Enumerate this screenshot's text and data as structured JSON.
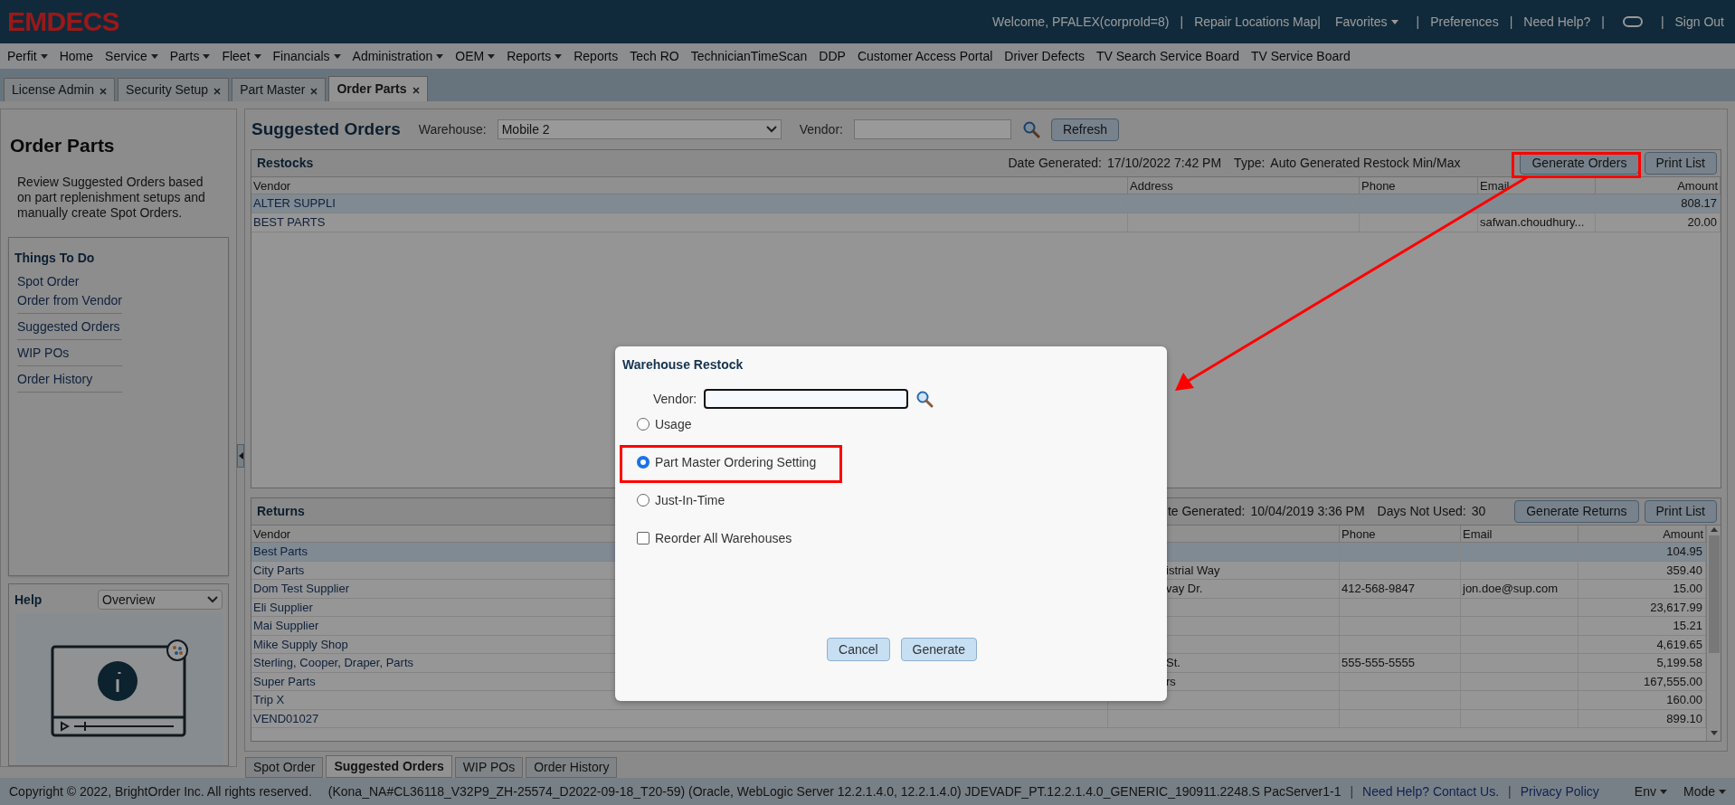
{
  "header": {
    "logo": "EMDECS",
    "items": [
      {
        "kind": "text",
        "label": "Welcome, PFALEX(corproId=8)"
      },
      {
        "kind": "sep",
        "label": "|"
      },
      {
        "kind": "link",
        "label": "Repair Locations Map|"
      },
      {
        "kind": "dropdown",
        "label": "Favorites"
      },
      {
        "kind": "sep",
        "label": "|"
      },
      {
        "kind": "link",
        "label": "Preferences"
      },
      {
        "kind": "sep",
        "label": "|"
      },
      {
        "kind": "link",
        "label": "Need Help?"
      },
      {
        "kind": "sep",
        "label": "|"
      },
      {
        "kind": "toggle",
        "on": false
      },
      {
        "kind": "sep",
        "label": "|"
      },
      {
        "kind": "link",
        "label": "Sign Out"
      }
    ]
  },
  "menu": [
    {
      "label": "Perfit",
      "dropdown": true
    },
    {
      "label": "Home",
      "dropdown": false
    },
    {
      "label": "Service",
      "dropdown": true
    },
    {
      "label": "Parts",
      "dropdown": true
    },
    {
      "label": "Fleet",
      "dropdown": true
    },
    {
      "label": "Financials",
      "dropdown": true
    },
    {
      "label": "Administration",
      "dropdown": true
    },
    {
      "label": "OEM",
      "dropdown": true
    },
    {
      "label": "Reports",
      "dropdown": true
    },
    {
      "label": "Reports",
      "dropdown": false
    },
    {
      "label": "Tech RO",
      "dropdown": false
    },
    {
      "label": "TechnicianTimeScan",
      "dropdown": false
    },
    {
      "label": "DDP",
      "dropdown": false
    },
    {
      "label": "Customer Access Portal",
      "dropdown": false
    },
    {
      "label": "Driver Defects",
      "dropdown": false
    },
    {
      "label": "TV Search Service Board",
      "dropdown": false
    },
    {
      "label": "TV Service Board",
      "dropdown": false
    }
  ],
  "tabs": [
    {
      "label": "License Admin",
      "selected": false
    },
    {
      "label": "Security Setup",
      "selected": false
    },
    {
      "label": "Part Master",
      "selected": false
    },
    {
      "label": "Order Parts",
      "selected": true
    }
  ],
  "sidebar": {
    "title": "Order Parts",
    "description": "Review Suggested Orders based on part replenishment setups and manually create Spot Orders.",
    "things_to_do": {
      "title": "Things To Do",
      "groups": [
        {
          "items": [
            "Spot Order",
            "Order from Vendor"
          ]
        },
        {
          "items": [
            "Suggested Orders"
          ]
        },
        {
          "items": [
            "WIP POs"
          ]
        },
        {
          "items": [
            "Order History"
          ]
        }
      ]
    },
    "help": {
      "title": "Help",
      "topic": "Overview"
    }
  },
  "main": {
    "title": "Suggested Orders",
    "warehouse_label": "Warehouse:",
    "warehouse": "Mobile 2",
    "vendor_label": "Vendor:",
    "refresh": "Refresh",
    "restocks": {
      "title": "Restocks",
      "date_label": "Date Generated:",
      "date": "17/10/2022 7:42 PM",
      "type_label": "Type:",
      "type": "Auto Generated Restock Min/Max",
      "buttons": [
        "Generate Orders",
        "Print List"
      ],
      "columns": [
        {
          "label": "Vendor"
        },
        {
          "label": "Address"
        },
        {
          "label": "Phone"
        },
        {
          "label": "Email"
        },
        {
          "label": "Amount"
        }
      ],
      "rows": [
        {
          "vendor": "ALTER SUPPLI",
          "amount": "808.17",
          "selected": true
        },
        {
          "vendor": "BEST PARTS",
          "email": "safwan.choudhury...",
          "amount": "20.00",
          "selected": false
        }
      ]
    },
    "returns": {
      "title": "Returns",
      "date_label": "te Generated:",
      "date": "10/04/2019 3:36 PM",
      "days_label": "Days Not Used:",
      "days": "30",
      "buttons": [
        "Generate Returns",
        "Print List"
      ],
      "columns": [
        {
          "label": "Vendor"
        },
        {},
        {
          "label": "Phone"
        },
        {
          "label": "Email"
        },
        {
          "label": "Amount"
        }
      ],
      "rows": [
        {
          "vendor": "Best Parts",
          "amount": "104.95",
          "selected": true
        },
        {
          "vendor": "City Parts",
          "address": "istrial Way",
          "amount": "359.40",
          "selected": false
        },
        {
          "vendor": "Dom Test Supplier",
          "address": "vay Dr.",
          "phone": "412-568-9847",
          "email": "jon.doe@sup.com",
          "amount": "15.00",
          "selected": false
        },
        {
          "vendor": "Eli Supplier",
          "amount": "23,617.99",
          "selected": false
        },
        {
          "vendor": "Mai Supplier",
          "amount": "15.21",
          "selected": false
        },
        {
          "vendor": "Mike Supply Shop",
          "amount": "4,619.65",
          "selected": false
        },
        {
          "vendor": "Sterling, Cooper, Draper, Parts",
          "address": "St.",
          "phone": "555-555-5555",
          "amount": "5,199.58",
          "selected": false
        },
        {
          "vendor": "Super Parts",
          "address": "rs",
          "amount": "167,555.00",
          "selected": false
        },
        {
          "vendor": "Trip X",
          "amount": "160.00",
          "selected": false
        },
        {
          "vendor": "VEND01027",
          "amount": "899.10",
          "selected": false
        }
      ]
    }
  },
  "bottom_tabs": [
    {
      "label": "Spot Order",
      "selected": false
    },
    {
      "label": "Suggested Orders",
      "selected": true
    },
    {
      "label": "WIP POs",
      "selected": false
    },
    {
      "label": "Order History",
      "selected": false
    }
  ],
  "footer": {
    "copyright": "Copyright © 2022, BrightOrder Inc. All rights reserved.",
    "build": "(Kona_NA#CL36118_V32P9_ZH-25574_D2022-09-18_T20-59) (Oracle, WebLogic Server 12.2.1.4.0, 12.2.1.4.0) JDEVADF_PT.12.2.1.4.0_GENERIC_190911.2248.S PacServer1-1",
    "links": [
      "Need Help? Contact Us.",
      "Privacy Policy"
    ],
    "separators": [
      "|",
      "|"
    ],
    "menus": [
      "Env",
      "Mode"
    ]
  },
  "dialog": {
    "title": "Warehouse Restock",
    "vendor_label": "Vendor:",
    "options": [
      {
        "label": "Usage",
        "selected": false
      },
      {
        "label": "Part Master Ordering Setting",
        "selected": true
      },
      {
        "label": "Just-In-Time",
        "selected": false
      }
    ],
    "reorder_all": {
      "label": "Reorder All Warehouses",
      "checked": false
    },
    "buttons": [
      "Cancel",
      "Generate"
    ]
  }
}
